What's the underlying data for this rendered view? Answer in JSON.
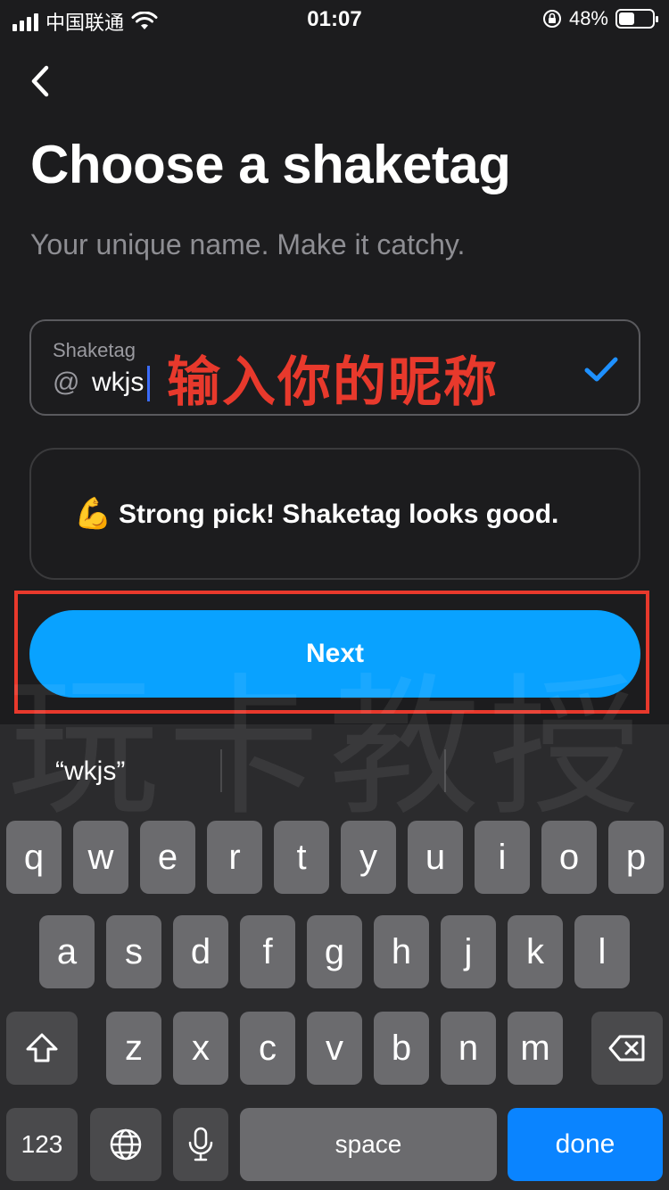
{
  "status_bar": {
    "carrier": "中国联通",
    "time": "01:07",
    "battery": "48%",
    "battery_level": 0.48
  },
  "page": {
    "title": "Choose a shaketag",
    "subtitle": "Your unique name. Make it catchy."
  },
  "input": {
    "label": "Shaketag",
    "prefix": "@",
    "value": "wkjs",
    "annotation": "输入你的昵称"
  },
  "message": {
    "icon": "💪",
    "text": "Strong pick! Shaketag looks good."
  },
  "next_label": "Next",
  "watermark": "玩卡教授",
  "keyboard": {
    "suggestion": "“wkjs”",
    "row1": [
      "q",
      "w",
      "e",
      "r",
      "t",
      "y",
      "u",
      "i",
      "o",
      "p"
    ],
    "row2": [
      "a",
      "s",
      "d",
      "f",
      "g",
      "h",
      "j",
      "k",
      "l"
    ],
    "row3": [
      "z",
      "x",
      "c",
      "v",
      "b",
      "n",
      "m"
    ],
    "numbers_label": "123",
    "space_label": "space",
    "done_label": "done"
  },
  "colors": {
    "accent": "#09a2ff",
    "annotation": "#e8392c",
    "check": "#1e90ff",
    "done_key": "#0a84ff"
  }
}
